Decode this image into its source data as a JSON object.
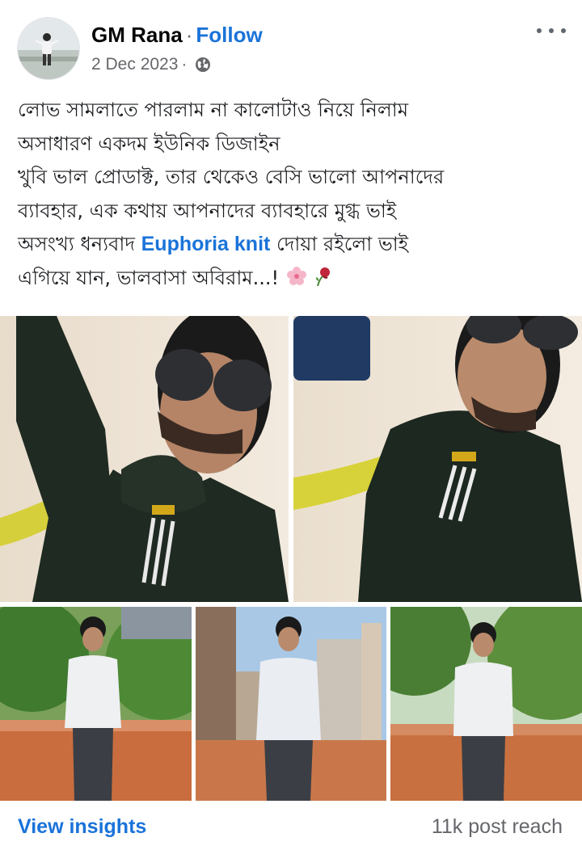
{
  "post": {
    "author": "GM Rana",
    "separator": "·",
    "follow_label": "Follow",
    "date": "2 Dec 2023",
    "meta_separator": "·",
    "audience_icon": "globe-icon",
    "options_icon": "more-horizontal-icon"
  },
  "caption": {
    "line1": "লোভ সামলাতে পারলাম না কালোটাও নিয়ে নিলাম",
    "line2": "অসাধারণ একদম ইউনিক ডিজাইন",
    "line3": "খুবি ভাল প্রোডাক্ট, তার থেকেও বেসি ভালো আপনাদের",
    "line4": "ব্যাবহার, এক কথায় আপনাদের ব্যাবহারে মুগ্ধ ভাই",
    "line5_before": "অসংখ্য ধন্যবাদ ",
    "line5_tag": "Euphoria knit",
    "line5_after": " দোয়া রইলো ভাই",
    "line6": "এগিয়ে যান, ভালবাসা অবিরাম...!",
    "emojis": [
      "cherry-blossom-emoji",
      "wilted-rose-emoji"
    ]
  },
  "photos": [
    {
      "name": "photo-black-hoodie-selfie-1",
      "subject": "black hoodie selfie"
    },
    {
      "name": "photo-black-hoodie-selfie-2",
      "subject": "black hoodie selfie"
    },
    {
      "name": "photo-white-hoodie-garden",
      "subject": "white hoodie outdoor"
    },
    {
      "name": "photo-white-hoodie-rooftop",
      "subject": "white hoodie rooftop"
    },
    {
      "name": "photo-white-hoodie-trees",
      "subject": "white hoodie outdoor"
    }
  ],
  "footer": {
    "insights_label": "View insights",
    "reach_text": "11k post reach"
  },
  "colors": {
    "link_blue": "#1a73d9",
    "secondary_text": "#65676b",
    "primary_text": "#1c1e21"
  }
}
